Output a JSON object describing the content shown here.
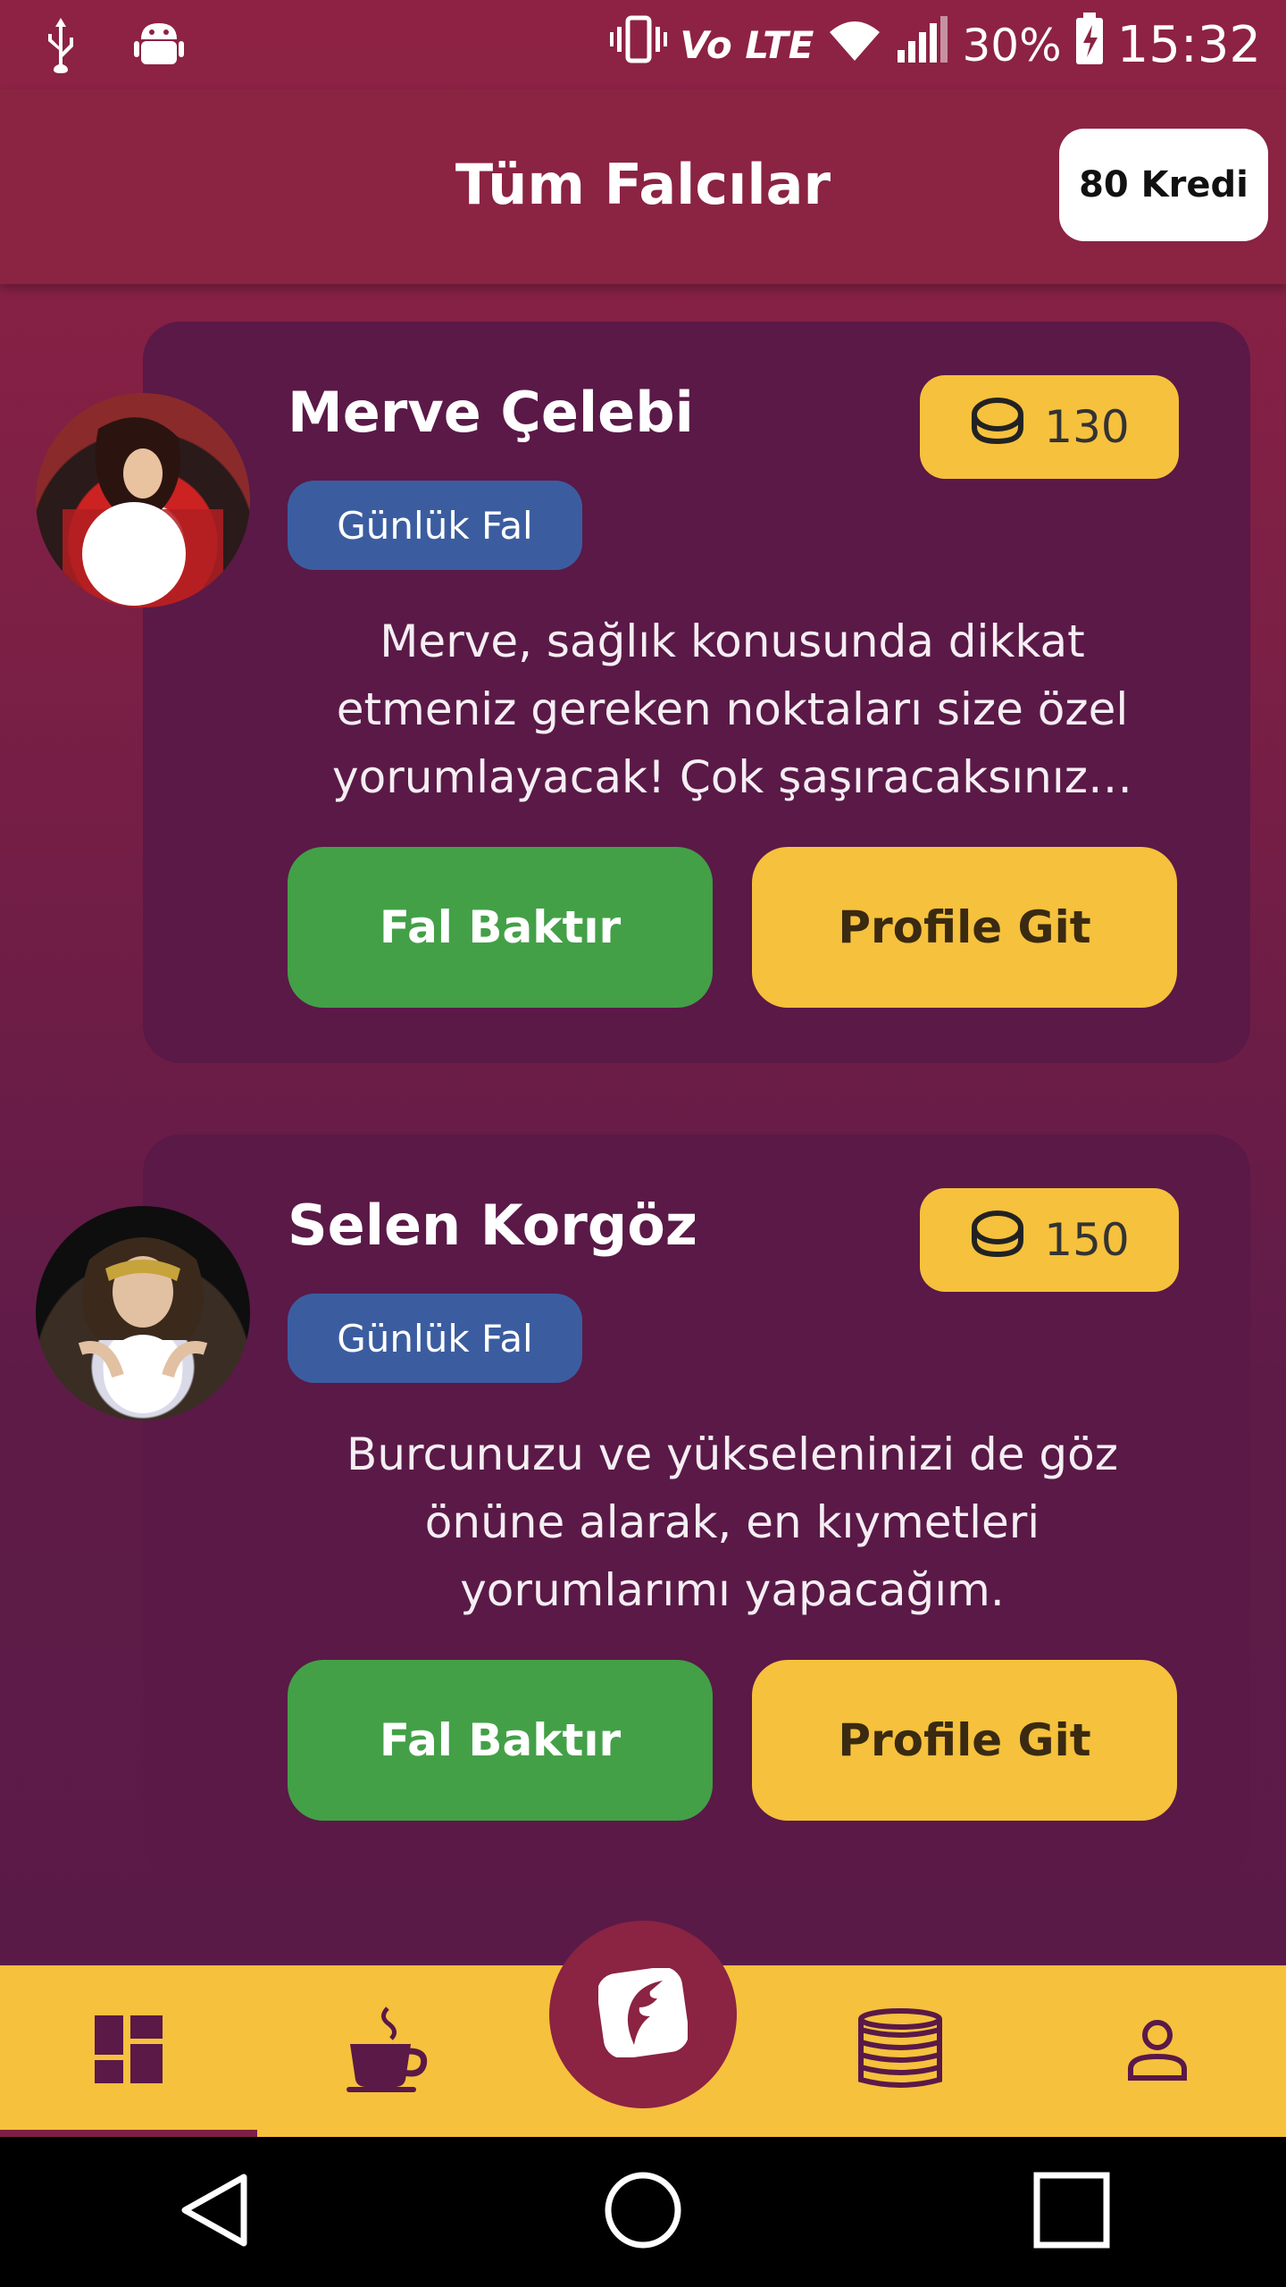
{
  "status_bar": {
    "network": "Vo LTE",
    "battery": "30%",
    "time": "15:32"
  },
  "header": {
    "title": "Tüm Falcılar",
    "credits": "80 Kredi"
  },
  "fortune_tellers": [
    {
      "name": "Merve Çelebi",
      "category": "Günlük Fal",
      "price": "130",
      "description": "Merve, sağlık konusunda dikkat etmeniz gereken noktaları size özel yorumlayacak! Çok şaşıracaksınız…",
      "primary_action": "Fal Baktır",
      "secondary_action": "Profile Git"
    },
    {
      "name": "Selen Korgöz",
      "category": "Günlük Fal",
      "price": "150",
      "description": "Burcunuzu ve yükseleninizi de göz önüne alarak, en kıymetleri yorumlarımı yapacağım.",
      "primary_action": "Fal Baktır",
      "secondary_action": "Profile Git"
    }
  ],
  "bottom_nav": {
    "items": [
      "dashboard-icon",
      "coffee-cup-icon",
      "feather-logo-icon",
      "coins-icon",
      "person-icon"
    ],
    "active": "dashboard-icon"
  },
  "colors": {
    "appbar": "#8b2343",
    "card": "#5a1947",
    "accent_yellow": "#f6c13c",
    "green": "#43a047",
    "badge_blue": "#3b5da0"
  }
}
